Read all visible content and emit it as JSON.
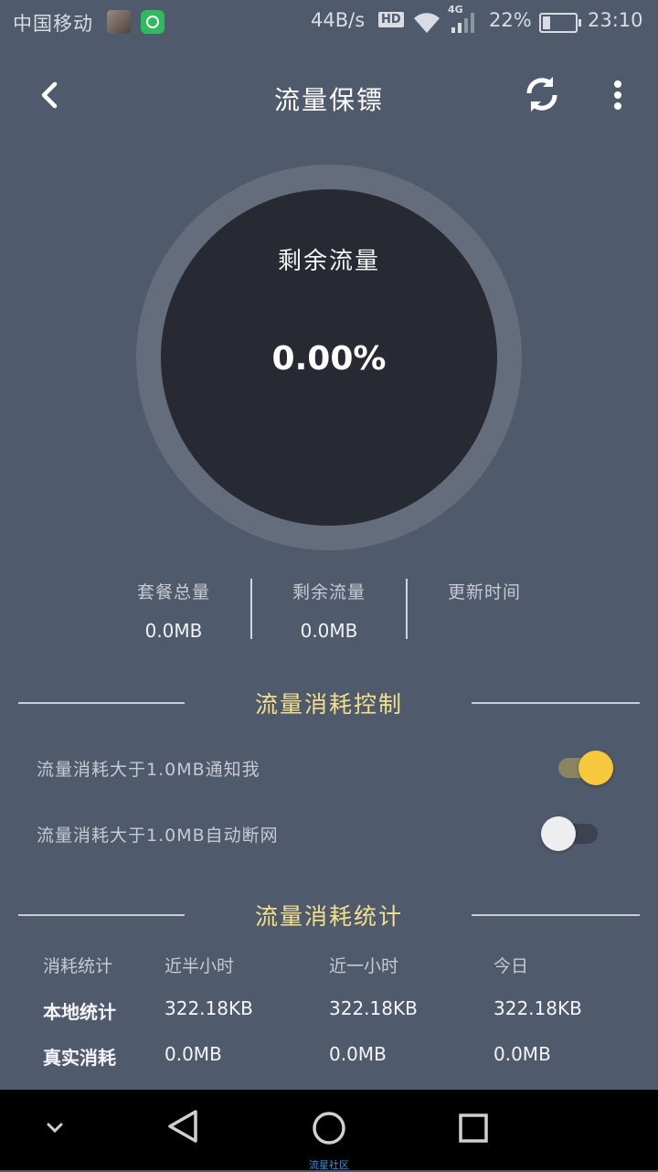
{
  "status_bar": {
    "carrier": "中国移动",
    "speed": "44B/s",
    "hd": "HD",
    "network": "4G",
    "battery_percent": "22%",
    "time": "23:10"
  },
  "app_bar": {
    "title": "流量保镖",
    "icons": [
      "chevron-left-icon",
      "refresh-icon",
      "more-vertical-icon"
    ]
  },
  "gauge": {
    "label": "剩余流量",
    "value": "0.00%",
    "remaining_fraction": 0.0
  },
  "summary": [
    {
      "label": "套餐总量",
      "value": "0.0MB"
    },
    {
      "label": "剩余流量",
      "value": "0.0MB"
    },
    {
      "label": "更新时间",
      "value": ""
    }
  ],
  "control": {
    "title": "流量消耗控制",
    "settings": [
      {
        "label": "流量消耗大于1.0MB通知我",
        "enabled": true
      },
      {
        "label": "流量消耗大于1.0MB自动断网",
        "enabled": false
      }
    ]
  },
  "stats": {
    "title": "流量消耗统计",
    "headers": [
      "消耗统计",
      "近半小时",
      "近一小时",
      "今日"
    ],
    "rows": [
      [
        "本地统计",
        "322.18KB",
        "322.18KB",
        "322.18KB"
      ],
      [
        "真实消耗",
        "0.0MB",
        "0.0MB",
        "0.0MB"
      ]
    ]
  },
  "nav_bar": {
    "watermark": "流星社区"
  },
  "colors": {
    "background": "#505a6d",
    "accent": "#f5c93b",
    "section_title": "#f3e08a"
  }
}
